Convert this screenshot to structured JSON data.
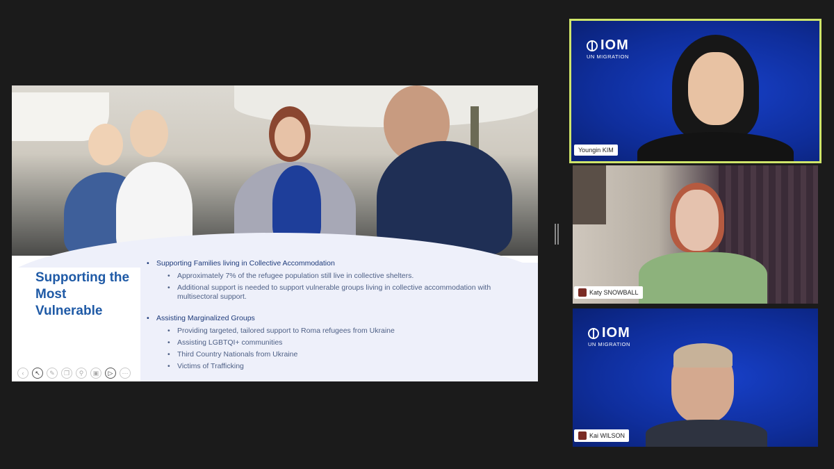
{
  "slide": {
    "title": "Supporting the\nMost\nVulnerable",
    "groups": [
      {
        "heading": "Supporting Families living in Collective Accommodation",
        "items": [
          "Approximately 7% of the refugee population still live in collective shelters.",
          "Additional support is needed to support vulnerable groups living in collective accommodation with multisectoral support."
        ]
      },
      {
        "heading": "Assisting Marginalized Groups",
        "items": [
          "Providing targeted, tailored support to Roma refugees from Ukraine",
          "Assisting LGBTQI+ communities",
          "Third Country Nationals from Ukraine",
          "Victims of Trafficking"
        ]
      }
    ],
    "toolbar_icons": [
      "back-icon",
      "pointer-icon",
      "pen-icon",
      "copy-icon",
      "zoom-icon",
      "subtitles-icon",
      "camera-icon",
      "more-icon"
    ]
  },
  "participants": [
    {
      "name": "Youngin KIM",
      "background": "IOM"
    },
    {
      "name": "Katy SNOWBALL",
      "background": "room"
    },
    {
      "name": "Kai WILSON",
      "background": "IOM"
    }
  ],
  "iom": {
    "brand": "IOM",
    "tagline": "UN MIGRATION"
  },
  "colors": {
    "active_speaker": "#cfe56a",
    "iom_blue": "#1740c8",
    "slide_title": "#1f5aa6"
  }
}
